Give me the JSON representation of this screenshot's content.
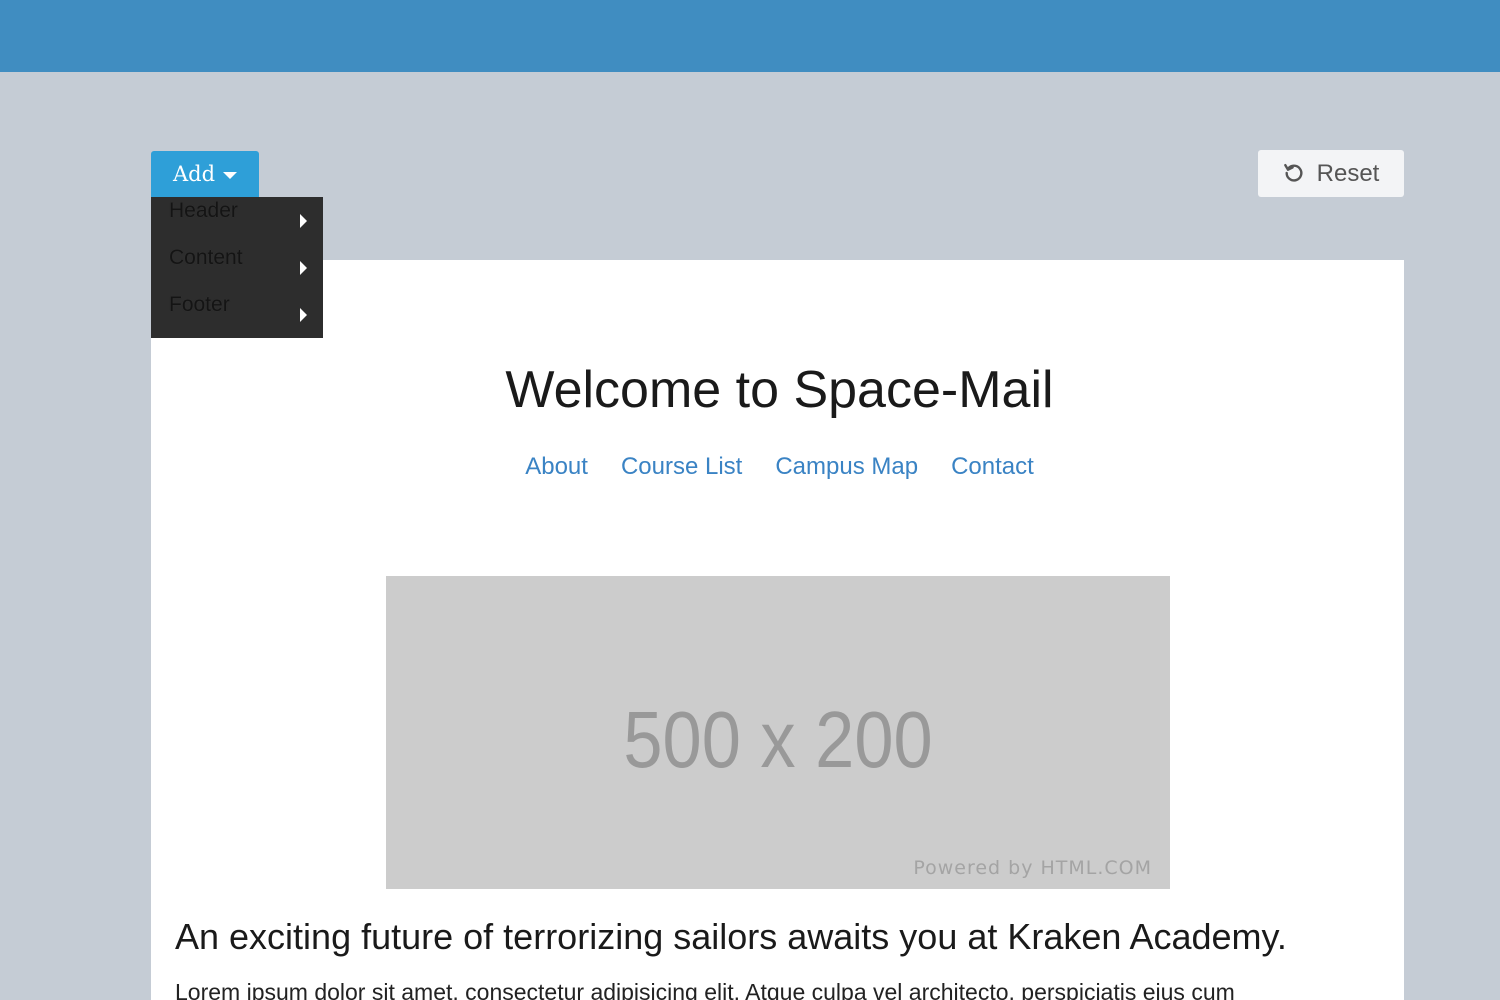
{
  "toolbar": {
    "add_label": "Add",
    "reset_label": "Reset",
    "add_menu": [
      {
        "label": "Header"
      },
      {
        "label": "Content"
      },
      {
        "label": "Footer"
      }
    ]
  },
  "colors": {
    "topbar": "#408dc1",
    "add_button": "#2e9fd8",
    "workspace_background": "#c5ccd5",
    "menu_background": "#2d2d2d",
    "nav_link": "#3a83c4"
  },
  "icons": {
    "add_caret": "caret-down-icon",
    "menu_submenu": "caret-right-icon",
    "reset": "undo-icon"
  },
  "page": {
    "title": "Welcome to Space-Mail",
    "nav": [
      "About",
      "Course List",
      "Campus Map",
      "Contact"
    ],
    "image_placeholder": {
      "dimensions": "500 x 200",
      "powered_by": "Powered by HTML.COM"
    },
    "subheading": "An exciting future of terrorizing sailors awaits you at Kraken Academy.",
    "body": "Lorem ipsum dolor sit amet, consectetur adipisicing elit. Atque culpa vel architecto, perspiciatis eius cum"
  }
}
